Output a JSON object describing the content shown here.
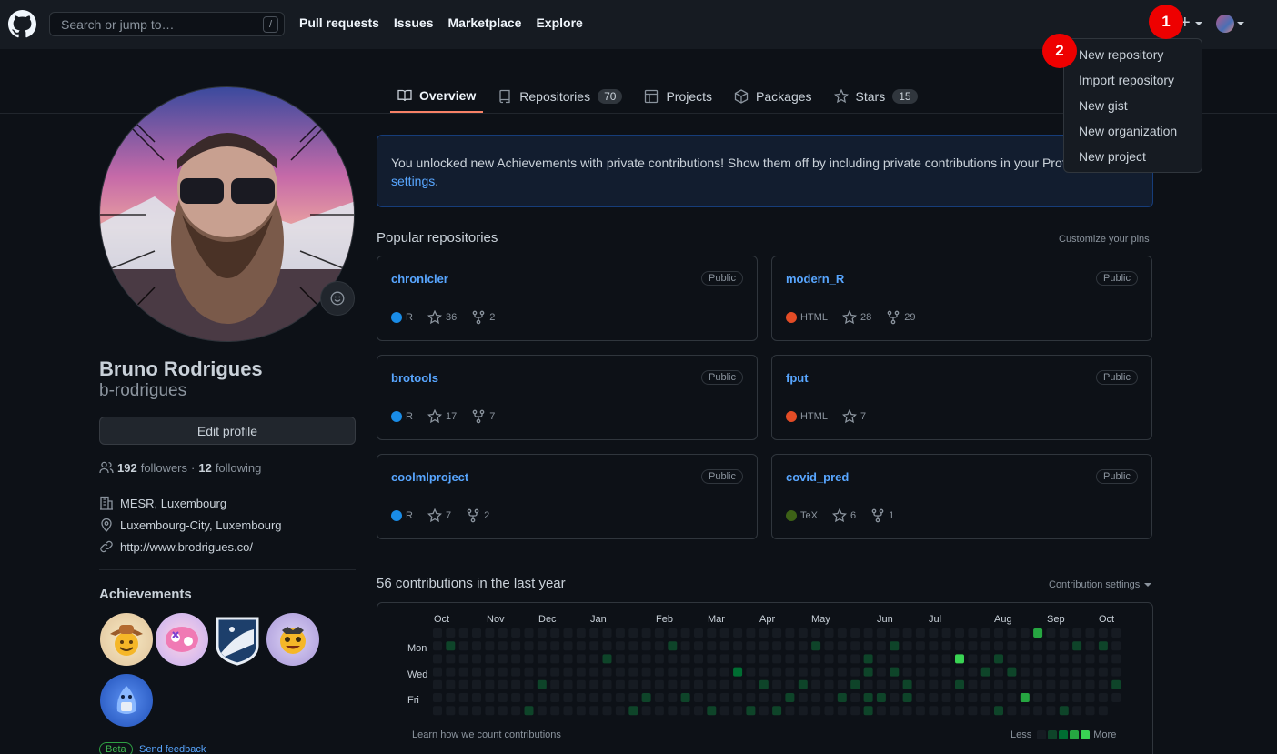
{
  "header": {
    "search_placeholder": "Search or jump to…",
    "search_shortcut": "/",
    "nav": [
      "Pull requests",
      "Issues",
      "Marketplace",
      "Explore"
    ],
    "plus": "+"
  },
  "markers": {
    "one": "1",
    "two": "2"
  },
  "create_menu": [
    "New repository",
    "Import repository",
    "New gist",
    "New organization",
    "New project"
  ],
  "tabs": [
    {
      "label": "Overview",
      "count": ""
    },
    {
      "label": "Repositories",
      "count": "70"
    },
    {
      "label": "Projects",
      "count": ""
    },
    {
      "label": "Packages",
      "count": ""
    },
    {
      "label": "Stars",
      "count": "15"
    }
  ],
  "profile": {
    "name": "Bruno Rodrigues",
    "login": "b-rodrigues",
    "edit_label": "Edit profile",
    "followers": "192",
    "followers_label": "followers",
    "sep": "·",
    "following": "12",
    "following_label": "following",
    "company": "MESR, Luxembourg",
    "location": "Luxembourg-City, Luxembourg",
    "website": "http://www.brodrigues.co/"
  },
  "achievements": {
    "title": "Achievements",
    "beta": "Beta",
    "feedback": "Send feedback"
  },
  "banner": {
    "text": "You unlocked new Achievements with private contributions! Show them off by including private contributions in your Profile in",
    "link": "settings",
    "end": "."
  },
  "popular": {
    "title": "Popular repositories",
    "customize": "Customize your pins",
    "repos": [
      {
        "name": "chronicler",
        "visibility": "Public",
        "lang": "R",
        "color": "#198ce7",
        "stars": "36",
        "forks": "2"
      },
      {
        "name": "modern_R",
        "visibility": "Public",
        "lang": "HTML",
        "color": "#e34c26",
        "stars": "28",
        "forks": "29"
      },
      {
        "name": "brotools",
        "visibility": "Public",
        "lang": "R",
        "color": "#198ce7",
        "stars": "17",
        "forks": "7"
      },
      {
        "name": "fput",
        "visibility": "Public",
        "lang": "HTML",
        "color": "#e34c26",
        "stars": "7",
        "forks": ""
      },
      {
        "name": "coolmlproject",
        "visibility": "Public",
        "lang": "R",
        "color": "#198ce7",
        "stars": "7",
        "forks": "2"
      },
      {
        "name": "covid_pred",
        "visibility": "Public",
        "lang": "TeX",
        "color": "#3d6117",
        "stars": "6",
        "forks": "1"
      }
    ]
  },
  "contributions": {
    "title": "56 contributions in the last year",
    "settings": "Contribution settings",
    "months": [
      "Oct",
      "Nov",
      "Dec",
      "Jan",
      "Feb",
      "Mar",
      "Apr",
      "May",
      "Jun",
      "Jul",
      "Aug",
      "Sep",
      "Oct"
    ],
    "days": [
      "Mon",
      "Wed",
      "Fri"
    ],
    "learn": "Learn how we count contributions",
    "less": "Less",
    "more": "More",
    "levels": [
      "#161b22",
      "#0e4429",
      "#006d32",
      "#26a641",
      "#39d353"
    ],
    "cells": [
      [
        1,
        1,
        1
      ],
      [
        7,
        6,
        1
      ],
      [
        8,
        4,
        1
      ],
      [
        13,
        2,
        1
      ],
      [
        14,
        7,
        1
      ],
      [
        15,
        6,
        1
      ],
      [
        16,
        5,
        1
      ],
      [
        18,
        1,
        1
      ],
      [
        19,
        5,
        1
      ],
      [
        21,
        6,
        1
      ],
      [
        22,
        7,
        1
      ],
      [
        23,
        3,
        2
      ],
      [
        24,
        6,
        1
      ],
      [
        25,
        4,
        1
      ],
      [
        26,
        6,
        1
      ],
      [
        27,
        5,
        1
      ],
      [
        28,
        4,
        1
      ],
      [
        29,
        1,
        1
      ],
      [
        31,
        5,
        1
      ],
      [
        32,
        4,
        1
      ],
      [
        33,
        2,
        1
      ],
      [
        33,
        3,
        1
      ],
      [
        33,
        5,
        1
      ],
      [
        33,
        6,
        1
      ],
      [
        34,
        5,
        1
      ],
      [
        35,
        1,
        1
      ],
      [
        35,
        3,
        1
      ],
      [
        36,
        4,
        1
      ],
      [
        36,
        5,
        1
      ],
      [
        40,
        2,
        4
      ],
      [
        40,
        4,
        1
      ],
      [
        42,
        3,
        1
      ],
      [
        43,
        6,
        1
      ],
      [
        44,
        3,
        1
      ],
      [
        43,
        2,
        1
      ],
      [
        45,
        5,
        3
      ],
      [
        46,
        0,
        3
      ],
      [
        48,
        6,
        1
      ],
      [
        49,
        1,
        1
      ],
      [
        51,
        1,
        1
      ],
      [
        52,
        4,
        1
      ],
      [
        53,
        4,
        2
      ]
    ]
  }
}
